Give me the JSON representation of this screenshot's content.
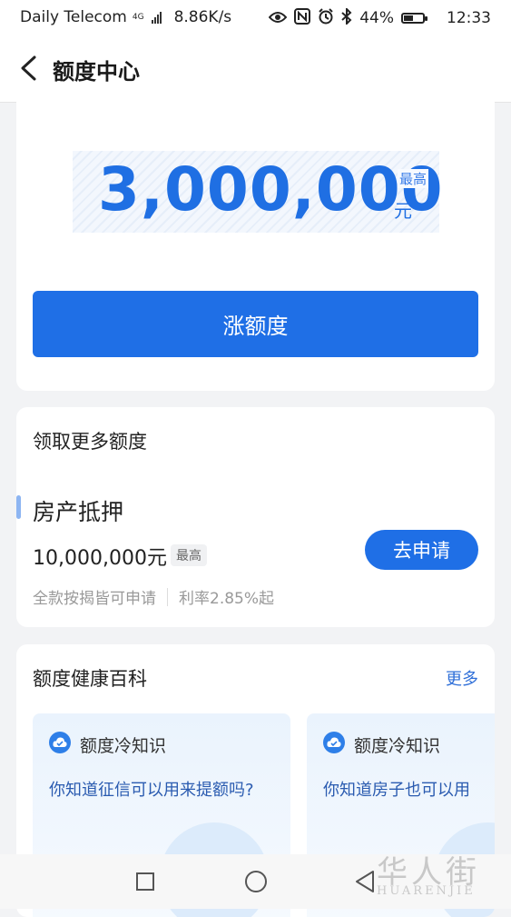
{
  "status_bar": {
    "carrier": "Daily Telecom",
    "network_type": "4G",
    "speed": "8.86K/s",
    "battery_percent": "44%",
    "battery_level": 0.44,
    "time": "12:33",
    "icons": [
      "eye-icon",
      "nfc-icon",
      "alarm-icon",
      "bluetooth-icon",
      "signal-icon",
      "battery-icon"
    ]
  },
  "nav": {
    "title": "额度中心"
  },
  "quota_card": {
    "amount": "3,000,000",
    "max_tag": "最高",
    "unit": "元",
    "raise_button": "涨额度"
  },
  "more_quota": {
    "title": "领取更多额度",
    "product": {
      "name": "房产抵押",
      "amount": "10,000,000元",
      "max_tag": "最高",
      "desc_left": "全款按揭皆可申请",
      "desc_right": "利率2.85%起",
      "apply_button": "去申请"
    }
  },
  "wiki": {
    "title": "额度健康百科",
    "more": "更多",
    "cards": [
      {
        "label": "额度冷知识",
        "question": "你知道征信可以用来提额吗?"
      },
      {
        "label": "额度冷知识",
        "question": "你知道房子也可以用"
      }
    ]
  },
  "watermark": {
    "cn": "华人街",
    "en": "HUARENJIE"
  },
  "colors": {
    "primary": "#1f6fe6",
    "background": "#f2f3f5",
    "link": "#2f6fd8"
  }
}
